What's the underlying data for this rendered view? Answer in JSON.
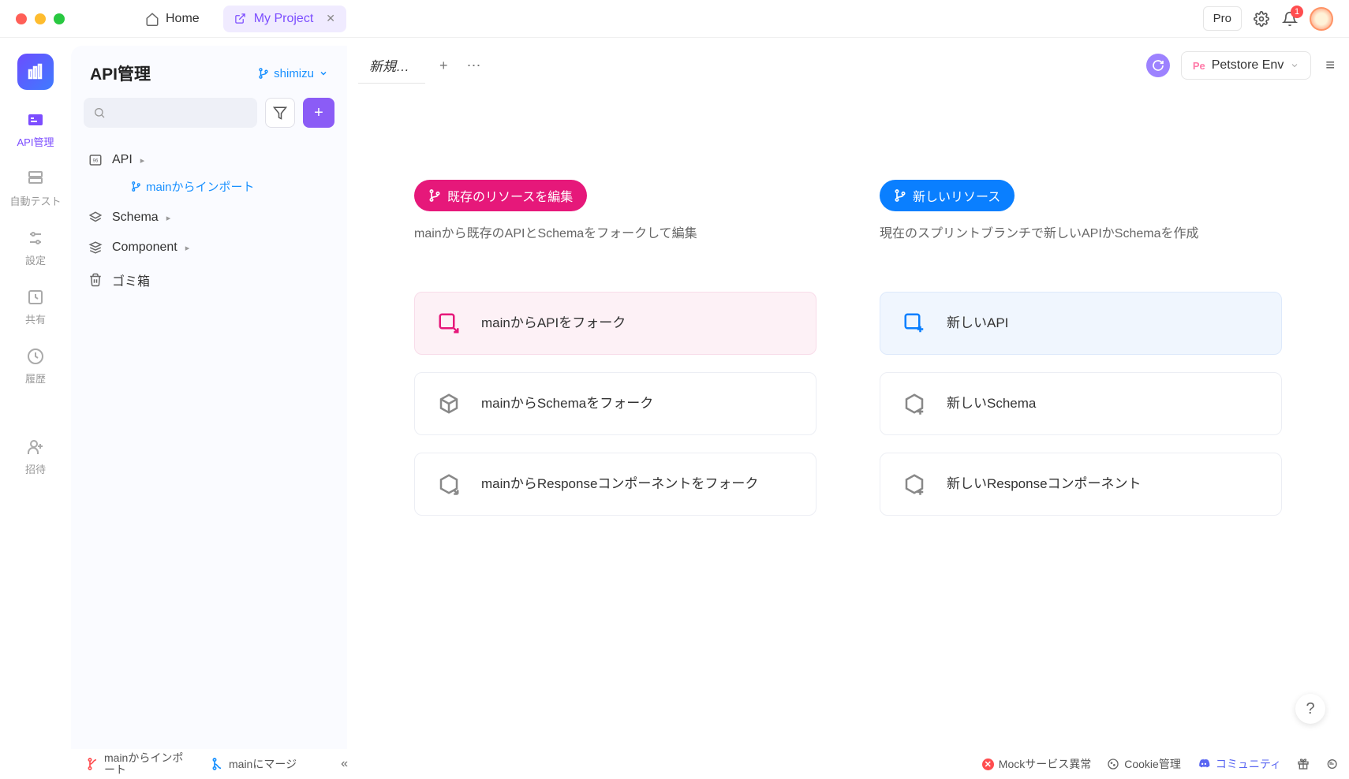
{
  "titlebar": {
    "home": "Home",
    "project": "My Project",
    "pro": "Pro",
    "notif_count": "1"
  },
  "rail": {
    "api_mgmt": "API管理",
    "auto_test": "自動テスト",
    "settings": "設定",
    "share": "共有",
    "history": "履歴",
    "invite": "招待"
  },
  "sidebar": {
    "title": "API管理",
    "branch": "shimizu",
    "search_ph": "",
    "tree": {
      "api": "API",
      "import": "mainからインポート",
      "schema": "Schema",
      "component": "Component",
      "trash": "ゴミ箱"
    }
  },
  "tabs": {
    "new": "新規…",
    "env": "Petstore Env",
    "env_badge": "Pe"
  },
  "left_panel": {
    "pill": "既存のリソースを編集",
    "desc": "mainから既存のAPIとSchemaをフォークして編集",
    "card1": "mainからAPIをフォーク",
    "card2": "mainからSchemaをフォーク",
    "card3": "mainからResponseコンポーネントをフォーク"
  },
  "right_panel": {
    "pill": "新しいリソース",
    "desc": "現在のスプリントブランチで新しいAPIかSchemaを作成",
    "card1": "新しいAPI",
    "card2": "新しいSchema",
    "card3": "新しいResponseコンポーネント"
  },
  "footer": {
    "import": "mainからインポート",
    "merge": "mainにマージ",
    "mock_err": "Mockサービス異常",
    "cookie": "Cookie管理",
    "community": "コミュニティ"
  }
}
